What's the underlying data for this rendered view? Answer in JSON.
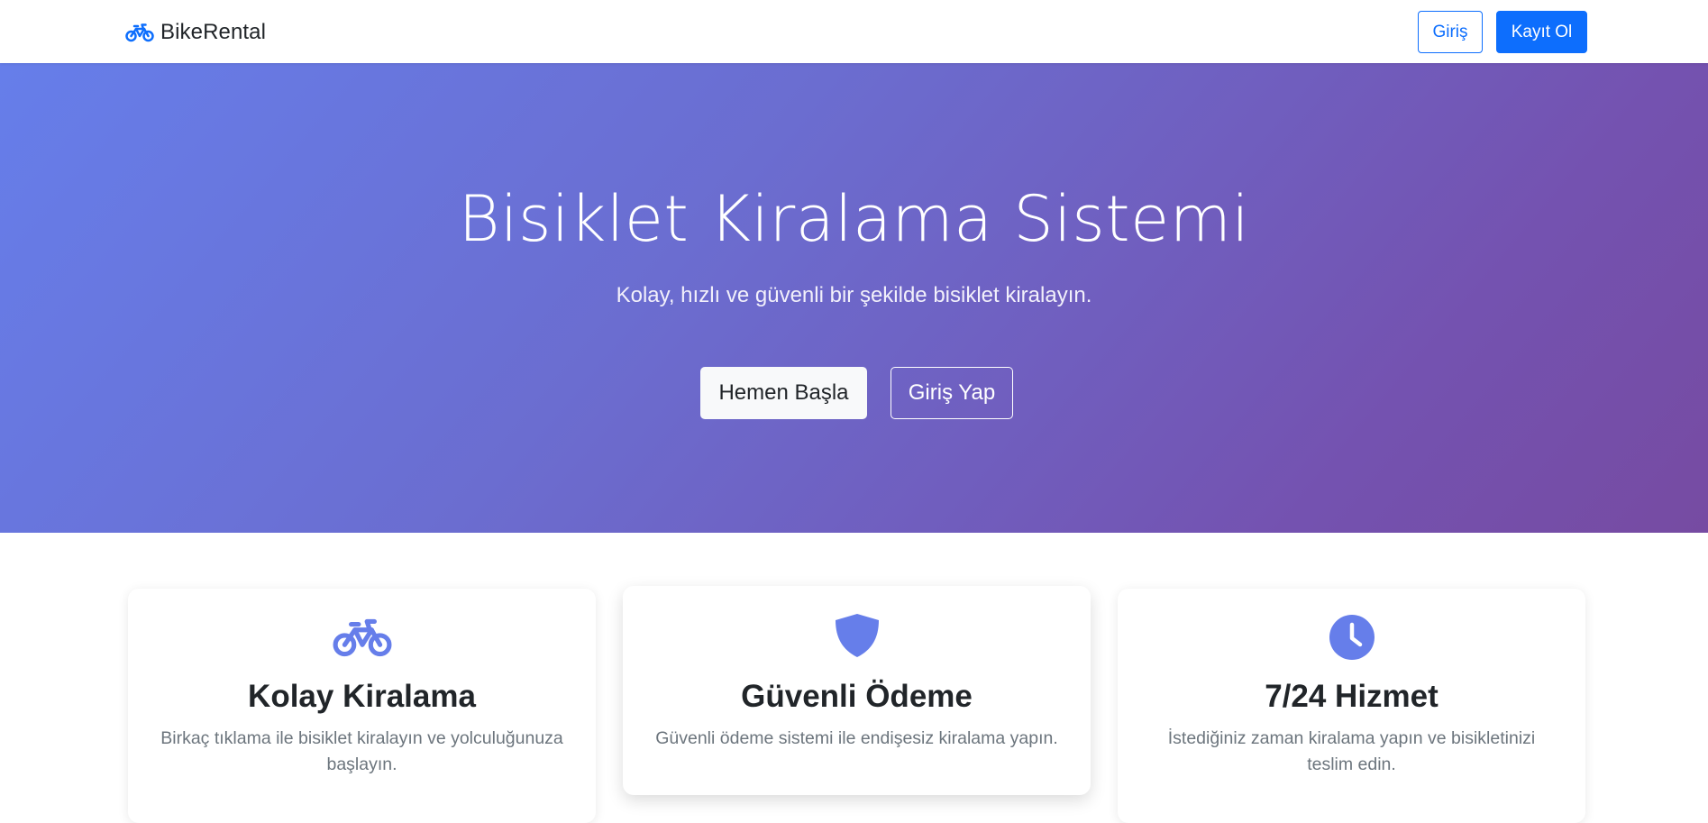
{
  "navbar": {
    "brand": "BikeRental",
    "brand_icon": "bicycle-icon",
    "login_label": "Giriş",
    "register_label": "Kayıt Ol"
  },
  "hero": {
    "title": "Bisiklet Kiralama Sistemi",
    "subtitle": "Kolay, hızlı ve güvenli bir şekilde bisiklet kiralayın.",
    "start_label": "Hemen Başla",
    "login_label": "Giriş Yap"
  },
  "features": [
    {
      "icon": "bicycle-icon",
      "title": "Kolay Kiralama",
      "text": "Birkaç tıklama ile bisiklet kiralayın ve yolculuğunuza başlayın."
    },
    {
      "icon": "shield-icon",
      "title": "Güvenli Ödeme",
      "text": "Güvenli ödeme sistemi ile endişesiz kiralama yapın."
    },
    {
      "icon": "clock-icon",
      "title": "7/24 Hizmet",
      "text": "İstediğiniz zaman kiralama yapın ve bisikletinizi teslim edin."
    }
  ],
  "colors": {
    "primary": "#0d6efd",
    "hero_gradient_start": "#667eea",
    "hero_gradient_end": "#764ba2",
    "feature_icon": "#667eea"
  }
}
